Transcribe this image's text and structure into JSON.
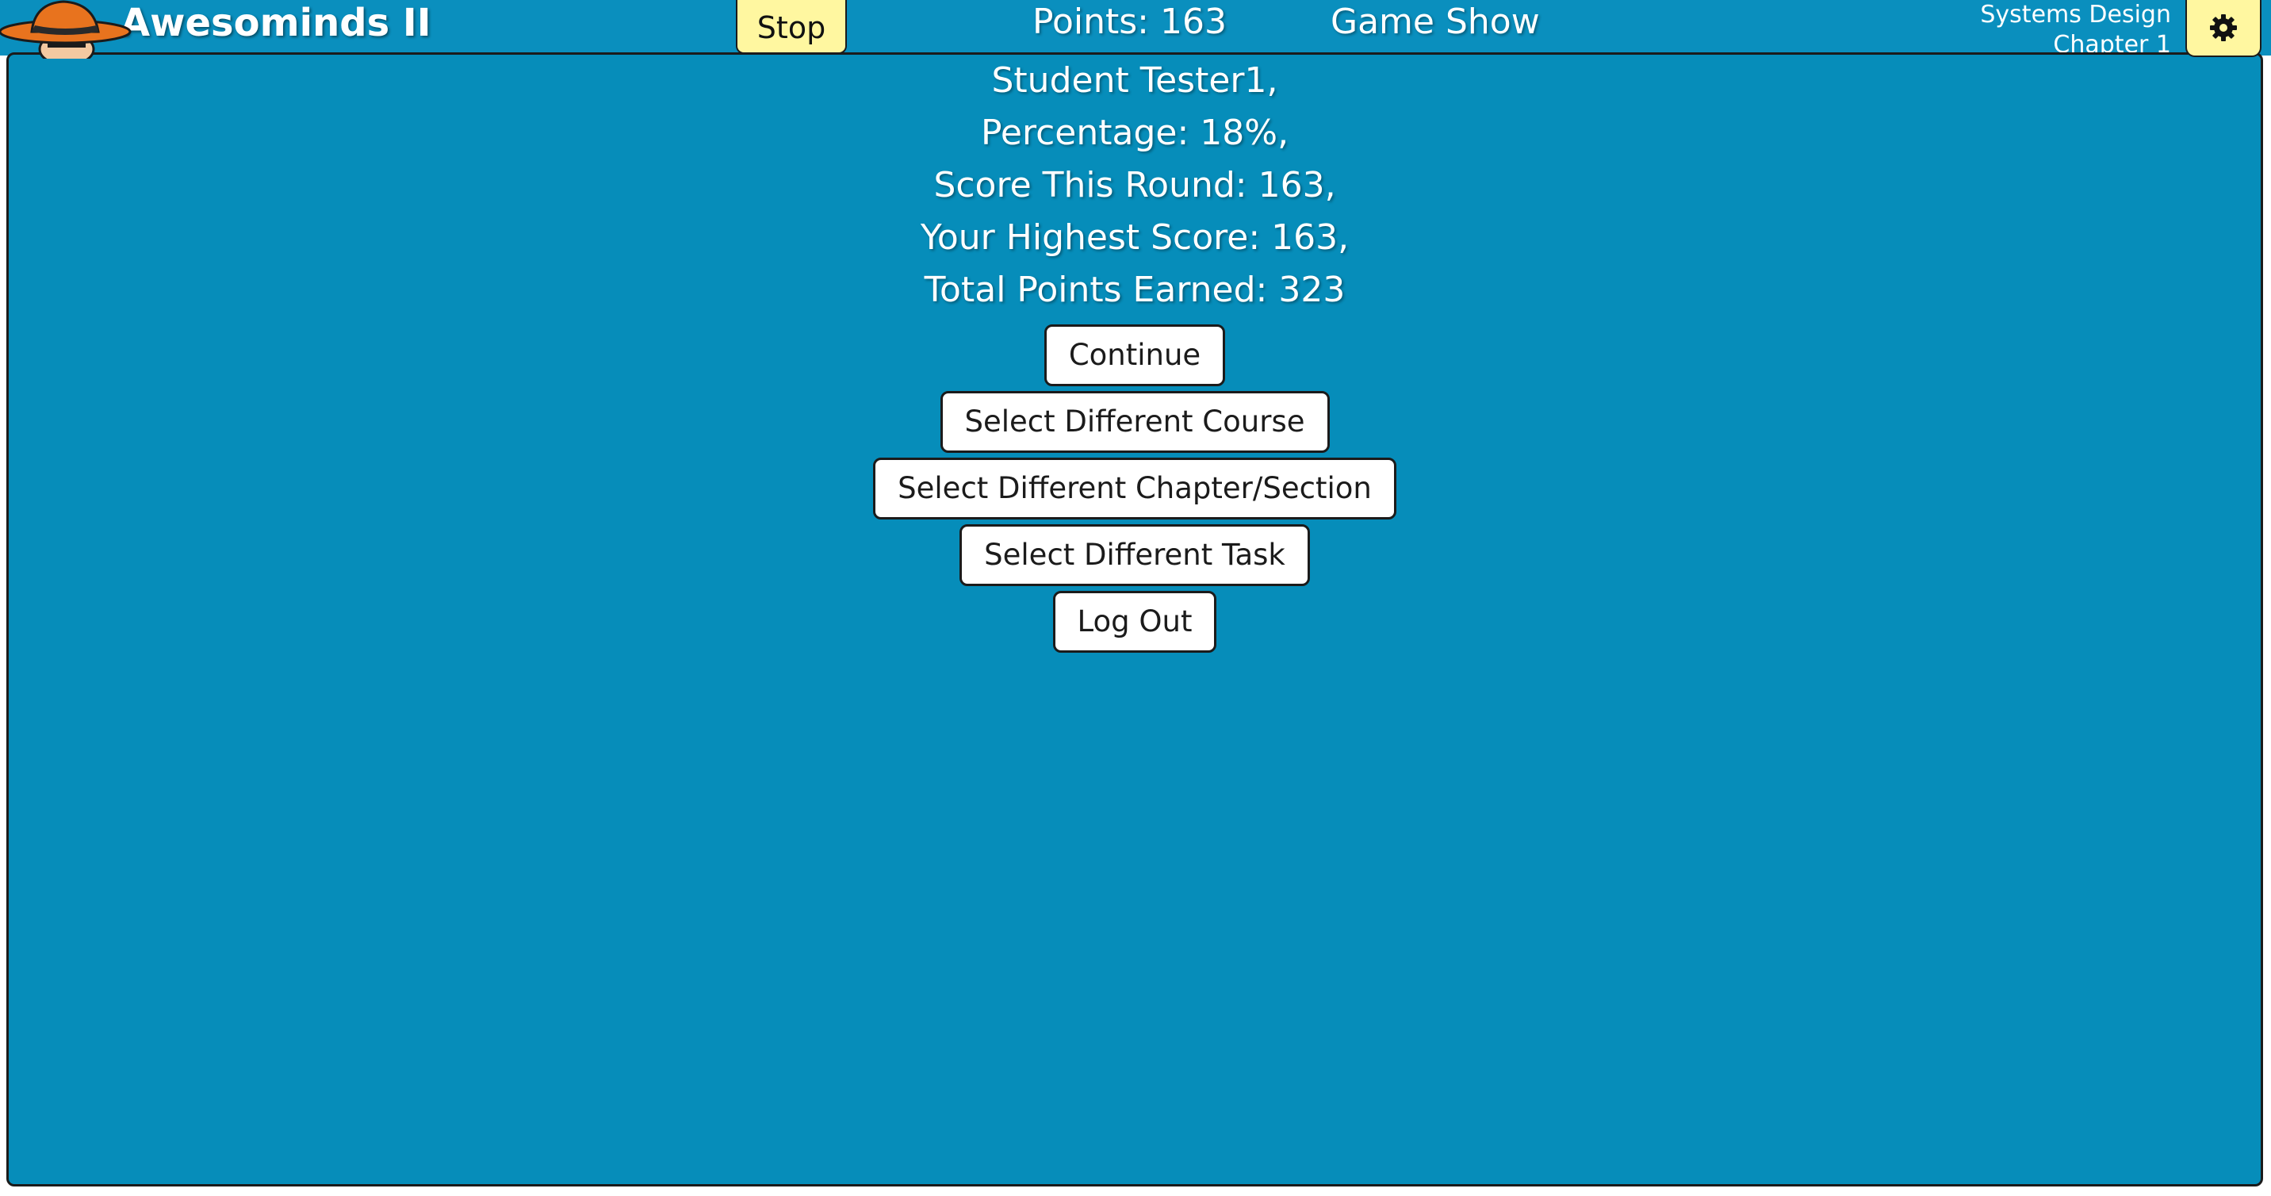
{
  "header": {
    "app_title": "Awesominds II",
    "stop_label": "Stop",
    "points_text": "Points: 163",
    "mode_label": "Game Show",
    "course_name": "Systems Design",
    "chapter_name": "Chapter 1",
    "settings_icon": "gear-icon",
    "mascot_icon": "mascot-detective-icon"
  },
  "results": {
    "student_line": "Student Tester1,",
    "percentage_line": "Percentage: 18%,",
    "score_round_line": "Score This Round: 163,",
    "highest_score_line": "Your Highest Score: 163,",
    "total_points_line": "Total Points Earned: 323"
  },
  "actions": {
    "continue_label": "Continue",
    "select_course_label": "Select Different Course",
    "select_chapter_label": "Select Different Chapter/Section",
    "select_task_label": "Select Different Task",
    "logout_label": "Log Out"
  },
  "colors": {
    "panel_background": "#068dba",
    "header_background": "#0a8fbe",
    "stop_button": "#fff7a0",
    "mascot_hat": "#e8731e"
  }
}
